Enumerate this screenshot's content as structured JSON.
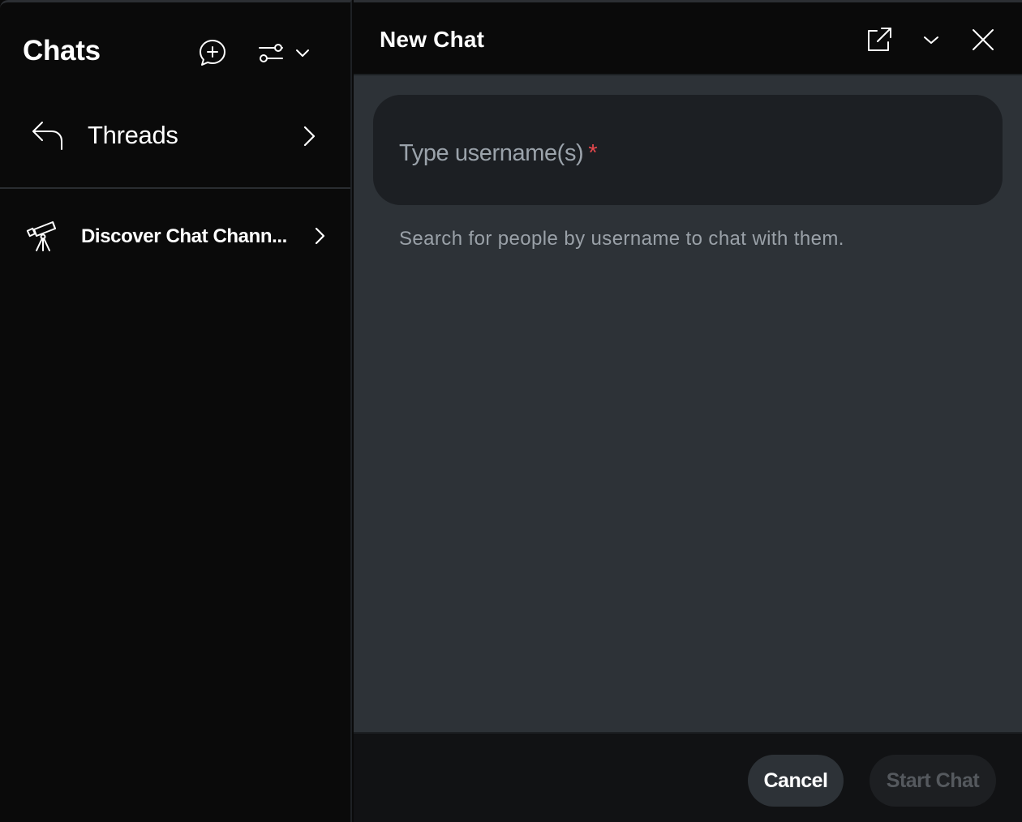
{
  "sidebar": {
    "title": "Chats",
    "threads_label": "Threads",
    "discover_label": "Discover Chat Chann..."
  },
  "panel": {
    "title": "New Chat",
    "input": {
      "placeholder": "Type username(s)",
      "required_mark": "*"
    },
    "hint": "Search for people by username to chat with them.",
    "cancel_label": "Cancel",
    "start_label": "Start Chat"
  },
  "colors": {
    "sidebar_bg": "#0a0a0a",
    "panel_bg": "#2d3237",
    "input_bg": "#1c1f23",
    "required": "#e5484d",
    "muted_text": "#9aa1a8"
  },
  "icons": [
    "new-chat-icon",
    "filter-icon",
    "chevron-down-icon",
    "back-arrow-icon",
    "chevron-right-icon",
    "telescope-icon",
    "external-link-icon",
    "close-icon"
  ]
}
